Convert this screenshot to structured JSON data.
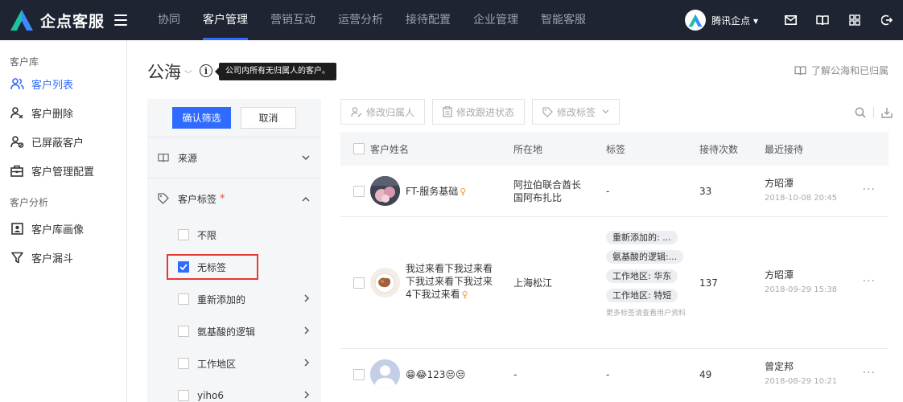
{
  "brand": {
    "name": "企点客服"
  },
  "nav": {
    "items": [
      "协同",
      "客户管理",
      "营销互动",
      "运营分析",
      "接待配置",
      "企业管理",
      "智能客服"
    ],
    "active": "客户管理"
  },
  "user": {
    "company": "腾讯企点 ▾"
  },
  "sidebar": {
    "section1": "客户库",
    "items1": [
      "客户列表",
      "客户删除",
      "已屏蔽客户",
      "客户管理配置"
    ],
    "section2": "客户分析",
    "items2": [
      "客户库画像",
      "客户漏斗"
    ]
  },
  "page": {
    "title": "公海",
    "tooltip": "公司内所有无归属人的客户。",
    "learn_link": "了解公海和已归属"
  },
  "filter": {
    "confirm": "确认筛选",
    "cancel": "取消",
    "groups": {
      "source": "来源",
      "tags": "客户标签",
      "required_mark": "*"
    },
    "options": [
      "不限",
      "无标签",
      "重新添加的",
      "氨基酸的逻辑",
      "工作地区",
      "yiho6"
    ]
  },
  "toolbar": {
    "change_owner": "修改归属人",
    "change_status": "修改跟进状态",
    "change_tags": "修改标签"
  },
  "table": {
    "headers": {
      "name": "客户姓名",
      "location": "所在地",
      "tags": "标签",
      "visits": "接待次数",
      "recent": "最近接待"
    },
    "rows": [
      {
        "name": "FT-服务基础",
        "location_line1": "阿拉伯联合酋长",
        "location_line2": "国阿布扎比",
        "tags": "-",
        "visits": "33",
        "agent": "方昭潭",
        "time": "2018-10-08 20:45",
        "more": "···"
      },
      {
        "name_line1": "我过来看下我过来看",
        "name_line2": "下我过来看下我过来",
        "name_line3": "4下我过来看",
        "location": "上海松江",
        "tag_list": [
          "重新添加的: ...",
          "氨基酸的逻辑:...",
          "工作地区: 华东",
          "工作地区: 特短"
        ],
        "tag_note": "更多标签请查看用户资料",
        "visits": "137",
        "agent": "方昭潭",
        "time": "2018-09-29 15:38",
        "more": "···"
      },
      {
        "name": "😁😂123😒😒",
        "location": "-",
        "tags": "-",
        "visits": "49",
        "agent": "曾定邦",
        "time": "2018-08-29 10:21",
        "more": "···"
      }
    ]
  },
  "colors": {
    "topbar": "#1f2433",
    "accent": "#2f6bff",
    "highlight": "#e53935"
  }
}
